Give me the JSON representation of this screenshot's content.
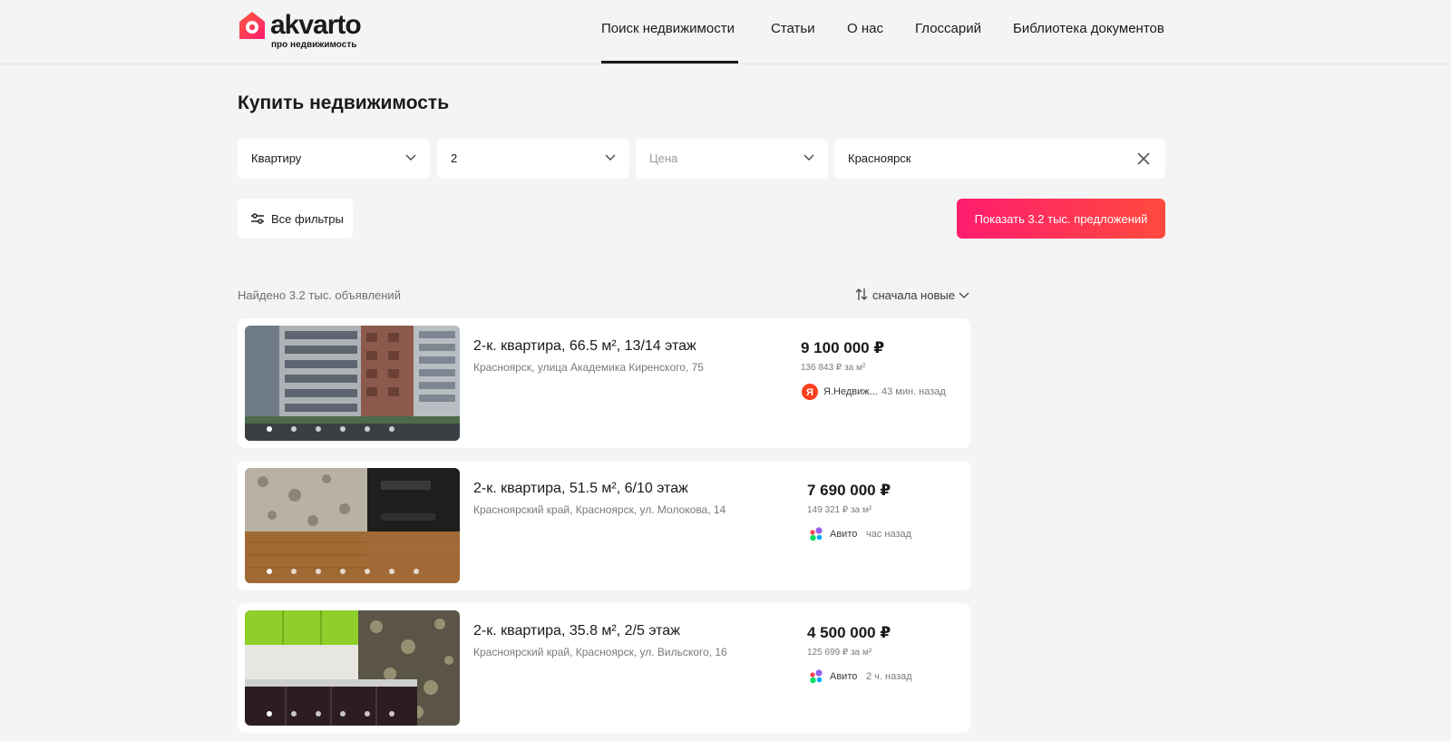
{
  "brand": {
    "name": "akvarto",
    "tagline": "про недвижимость",
    "accent_color": "#ff2f68"
  },
  "nav": {
    "items": [
      {
        "label": "Поиск недвижимости",
        "active": true
      },
      {
        "label": "Статьи"
      },
      {
        "label": "О нас"
      },
      {
        "label": "Глоссарий"
      },
      {
        "label": "Библиотека документов"
      }
    ]
  },
  "page": {
    "title": "Купить недвижимость"
  },
  "search": {
    "property_type": "Квартиру",
    "rooms": "2",
    "price_placeholder": "Цена",
    "city": "Красноярск",
    "all_filters_label": "Все фильтры",
    "show_button_label": "Показать 3.2 тыс. предложений",
    "show_button_colors": [
      "#ff1c6f",
      "#ff4a3d"
    ]
  },
  "results": {
    "found_text": "Найдено 3.2 тыс. объявлений",
    "sort_label": "сначала новые"
  },
  "listings": [
    {
      "title": "2-к. квартира, 66.5 м², 13/14 этаж",
      "address": "Красноярск, улица Академика Киренского, 75",
      "price": "9 100 000 ₽",
      "price_per_m2": "136 843 ₽ за м²",
      "source": "Я.Недвиж...",
      "source_icon": "yandex-icon",
      "time": "43 мин. назад",
      "photo_dots": 6,
      "active_dot": 0
    },
    {
      "title": "2-к. квартира, 51.5 м², 6/10 этаж",
      "address": "Красноярский край, Красноярск, ул. Молокова, 14",
      "price": "7 690 000 ₽",
      "price_per_m2": "149 321 ₽ за м²",
      "source": "Авито",
      "source_icon": "avito-icon",
      "time": "час назад",
      "photo_dots": 7,
      "active_dot": 0
    },
    {
      "title": "2-к. квартира, 35.8 м², 2/5 этаж",
      "address": "Красноярский край, Красноярск, ул. Вильского, 16",
      "price": "4 500 000 ₽",
      "price_per_m2": "125 699 ₽ за м²",
      "source": "Авито",
      "source_icon": "avito-icon",
      "time": "2 ч. назад",
      "photo_dots": 6,
      "active_dot": 0
    }
  ]
}
